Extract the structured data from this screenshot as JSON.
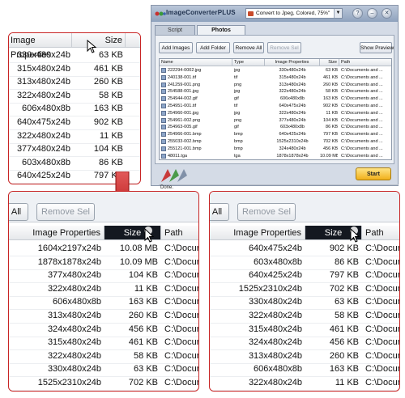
{
  "app": {
    "title": "ImageConverterPLUS",
    "preset": "Convert to Jpeg, Colored, 75%\"",
    "title_buttons": [
      "?",
      "–",
      "✕"
    ],
    "tabs": [
      {
        "label": "Script",
        "active": false
      },
      {
        "label": "Photos",
        "active": true
      }
    ],
    "buttons": {
      "add_images": "Add Images",
      "add_folder": "Add Folder",
      "remove_all": "Remove All",
      "remove_sel": "Remove Sel",
      "show_preview": "Show Preview"
    },
    "columns": {
      "name": "Name",
      "type": "Type",
      "props": "Image Properties",
      "size": "Size",
      "path": "Path"
    },
    "rows": [
      {
        "name": "222294-0002.jpg",
        "type": "jpg",
        "props": "330x480x24b",
        "size": "63 KB",
        "path": "C:\\Documents and ..."
      },
      {
        "name": "240138-001.tif",
        "type": "tif",
        "props": "315x480x24b",
        "size": "461 KB",
        "path": "C:\\Documents and ..."
      },
      {
        "name": "241259-001.png",
        "type": "png",
        "props": "313x480x24b",
        "size": "260 KB",
        "path": "C:\\Documents and ..."
      },
      {
        "name": "254588-001.jpg",
        "type": "jpg",
        "props": "322x480x24b",
        "size": "58 KB",
        "path": "C:\\Documents and ..."
      },
      {
        "name": "254944-002.gif",
        "type": "gif",
        "props": "606x480x8b",
        "size": "163 KB",
        "path": "C:\\Documents and ..."
      },
      {
        "name": "254951-001.tif",
        "type": "tif",
        "props": "640x475x24b",
        "size": "902 KB",
        "path": "C:\\Documents and ..."
      },
      {
        "name": "254960-001.jpg",
        "type": "jpg",
        "props": "322x480x24b",
        "size": "11 KB",
        "path": "C:\\Documents and ..."
      },
      {
        "name": "254961-002.png",
        "type": "png",
        "props": "377x480x24b",
        "size": "104 KB",
        "path": "C:\\Documents and ..."
      },
      {
        "name": "254963-005.gif",
        "type": "gif",
        "props": "603x480x8b",
        "size": "86 KB",
        "path": "C:\\Documents and ..."
      },
      {
        "name": "254966-001.bmp",
        "type": "bmp",
        "props": "640x425x24b",
        "size": "797 KB",
        "path": "C:\\Documents and ..."
      },
      {
        "name": "255033-002.bmp",
        "type": "bmp",
        "props": "1525x2310x24b",
        "size": "702 KB",
        "path": "C:\\Documents and ..."
      },
      {
        "name": "255121-001.bmp",
        "type": "bmp",
        "props": "324x480x24b",
        "size": "456 KB",
        "path": "C:\\Documents and ..."
      },
      {
        "name": "48011.tga",
        "type": "tga",
        "props": "1878x1878x24b",
        "size": "10.09 MB",
        "path": "C:\\Documents and ..."
      }
    ],
    "status": "Done.",
    "start_label": "Start"
  },
  "zoom1": {
    "columns": {
      "props": "Image Properties",
      "size": "Size"
    },
    "rows": [
      {
        "props": "330x480x24b",
        "size": "63 KB"
      },
      {
        "props": "315x480x24b",
        "size": "461 KB"
      },
      {
        "props": "313x480x24b",
        "size": "260 KB"
      },
      {
        "props": "322x480x24b",
        "size": "58 KB"
      },
      {
        "props": "606x480x8b",
        "size": "163 KB"
      },
      {
        "props": "640x475x24b",
        "size": "902 KB"
      },
      {
        "props": "322x480x24b",
        "size": "11 KB"
      },
      {
        "props": "377x480x24b",
        "size": "104 KB"
      },
      {
        "props": "603x480x8b",
        "size": "86 KB"
      },
      {
        "props": "640x425x24b",
        "size": "797 KB"
      }
    ]
  },
  "zoom2": {
    "buttons": {
      "remove_all": "All",
      "remove_sel": "Remove Sel"
    },
    "columns": {
      "props": "Image Properties",
      "size": "Size",
      "path": "Path"
    },
    "rows": [
      {
        "props": "1604x2197x24b",
        "size": "10.08 MB",
        "path": "C:\\Docur"
      },
      {
        "props": "1878x1878x24b",
        "size": "10.09 MB",
        "path": "C:\\Docur"
      },
      {
        "props": "377x480x24b",
        "size": "104 KB",
        "path": "C:\\Docur"
      },
      {
        "props": "322x480x24b",
        "size": "11 KB",
        "path": "C:\\Docur"
      },
      {
        "props": "606x480x8b",
        "size": "163 KB",
        "path": "C:\\Docur"
      },
      {
        "props": "313x480x24b",
        "size": "260 KB",
        "path": "C:\\Docur"
      },
      {
        "props": "324x480x24b",
        "size": "456 KB",
        "path": "C:\\Docur"
      },
      {
        "props": "315x480x24b",
        "size": "461 KB",
        "path": "C:\\Docur"
      },
      {
        "props": "322x480x24b",
        "size": "58 KB",
        "path": "C:\\Docur"
      },
      {
        "props": "330x480x24b",
        "size": "63 KB",
        "path": "C:\\Docur"
      },
      {
        "props": "1525x2310x24b",
        "size": "702 KB",
        "path": "C:\\Docur"
      }
    ]
  },
  "zoom3": {
    "buttons": {
      "remove_all": "All",
      "remove_sel": "Remove Sel"
    },
    "columns": {
      "props": "Image Properties",
      "size": "Size",
      "path": "Path"
    },
    "rows": [
      {
        "props": "640x475x24b",
        "size": "902 KB",
        "path": "C:\\Docur"
      },
      {
        "props": "603x480x8b",
        "size": "86 KB",
        "path": "C:\\Docur"
      },
      {
        "props": "640x425x24b",
        "size": "797 KB",
        "path": "C:\\Docur"
      },
      {
        "props": "1525x2310x24b",
        "size": "702 KB",
        "path": "C:\\Docur"
      },
      {
        "props": "330x480x24b",
        "size": "63 KB",
        "path": "C:\\Docur"
      },
      {
        "props": "322x480x24b",
        "size": "58 KB",
        "path": "C:\\Docur"
      },
      {
        "props": "315x480x24b",
        "size": "461 KB",
        "path": "C:\\Docur"
      },
      {
        "props": "324x480x24b",
        "size": "456 KB",
        "path": "C:\\Docur"
      },
      {
        "props": "313x480x24b",
        "size": "260 KB",
        "path": "C:\\Docur"
      },
      {
        "props": "606x480x8b",
        "size": "163 KB",
        "path": "C:\\Docur"
      },
      {
        "props": "322x480x24b",
        "size": "11 KB",
        "path": "C:\\Docur"
      }
    ]
  },
  "colors": {
    "highlight_border": "#c82424",
    "selected_header": "#141820",
    "start_button": "#f1b01a"
  }
}
